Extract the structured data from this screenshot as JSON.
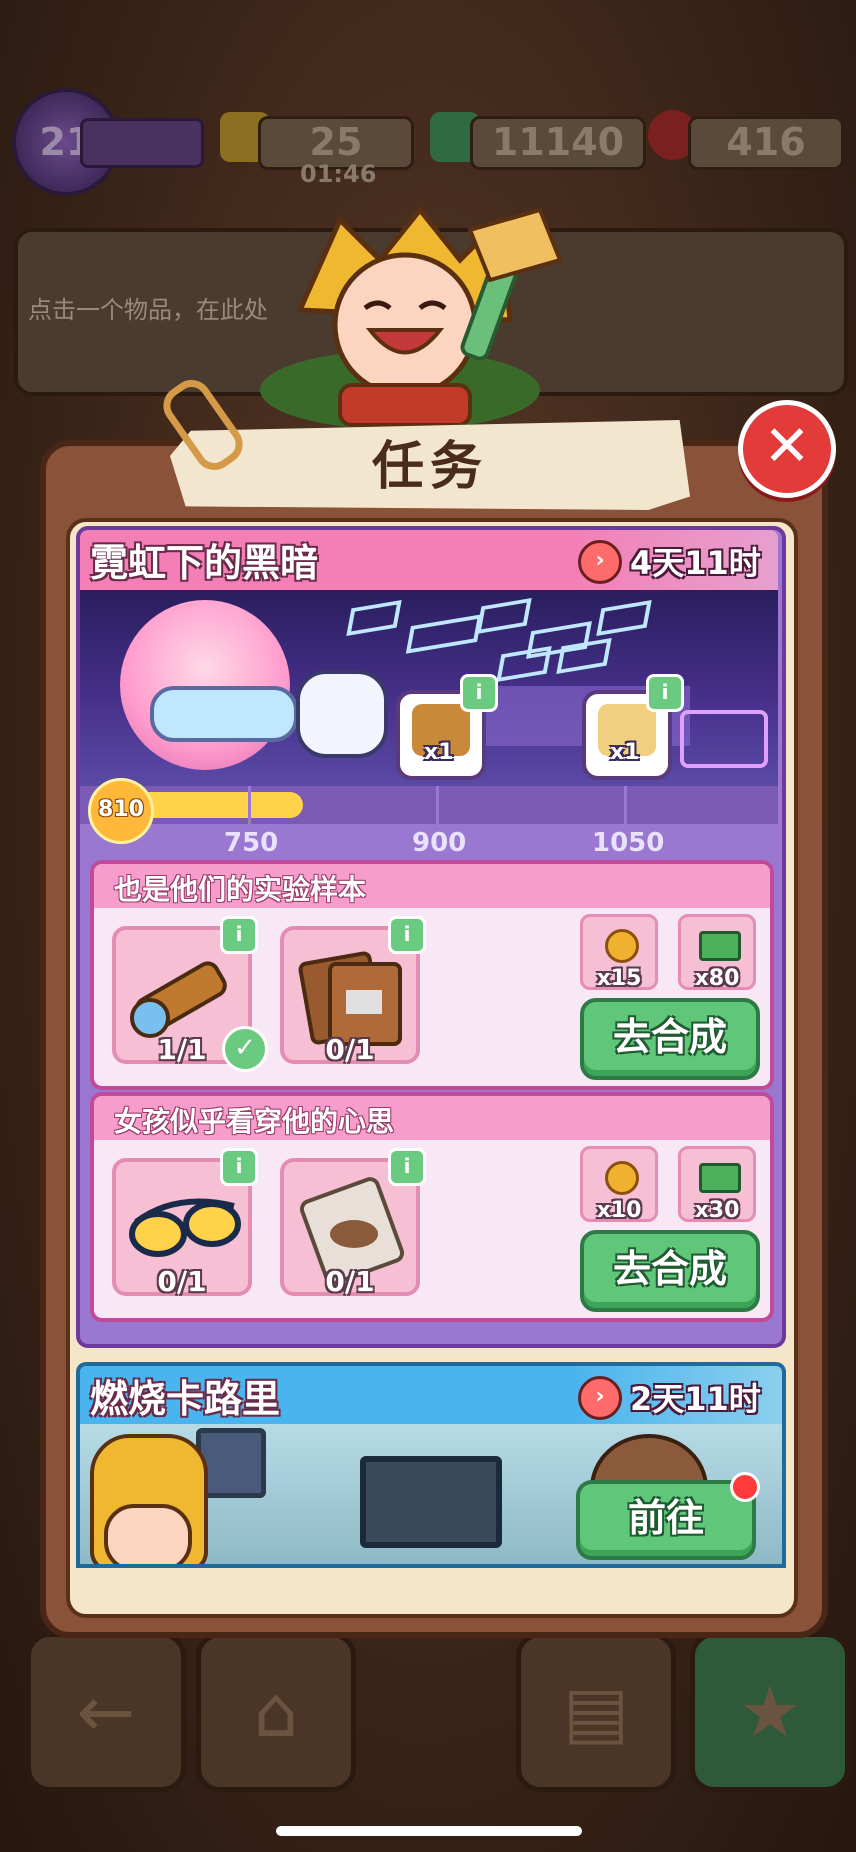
{
  "top_bar": {
    "level": "21",
    "energy": "25",
    "energy_timer": "01:46",
    "cash": "11140",
    "gems": "416"
  },
  "hint_panel": {
    "text": "点击一个物品，在此处"
  },
  "modal": {
    "title": "任务",
    "close_symbol": "✕"
  },
  "event": {
    "name": "霓虹下的黑暗",
    "timer": "4天11时",
    "points": "810",
    "progress_fraction": 0.3,
    "milestones": [
      "750",
      "900",
      "1050"
    ],
    "rewards": [
      {
        "icon": "treasure-chest-icon",
        "count": "x1"
      },
      {
        "icon": "hourglass-icon",
        "count": "x1"
      }
    ]
  },
  "tasks": [
    {
      "title": "也是他们的实验样本",
      "items": [
        {
          "icon": "telescope-icon",
          "count": "1/1",
          "done": true
        },
        {
          "icon": "envelope-icon",
          "count": "0/1",
          "done": false
        }
      ],
      "rewards": [
        {
          "icon": "flower-coin-icon",
          "count": "x15"
        },
        {
          "icon": "cash-icon",
          "count": "x80"
        }
      ],
      "button_label": "去合成"
    },
    {
      "title": "女孩似乎看穿他的心思",
      "items": [
        {
          "icon": "sunglasses-icon",
          "count": "0/1",
          "done": false
        },
        {
          "icon": "evidence-bag-icon",
          "count": "0/1",
          "done": false
        }
      ],
      "rewards": [
        {
          "icon": "flower-coin-icon",
          "count": "x10"
        },
        {
          "icon": "cash-icon",
          "count": "x30"
        }
      ],
      "button_label": "去合成"
    }
  ],
  "event2": {
    "name": "燃烧卡路里",
    "timer": "2天11时",
    "button_label": "前往"
  },
  "colors": {
    "event_header": "#f37fb6",
    "event2_header": "#4ab4ee",
    "go_button": "#5fc67a",
    "close_button": "#e33a3a"
  }
}
